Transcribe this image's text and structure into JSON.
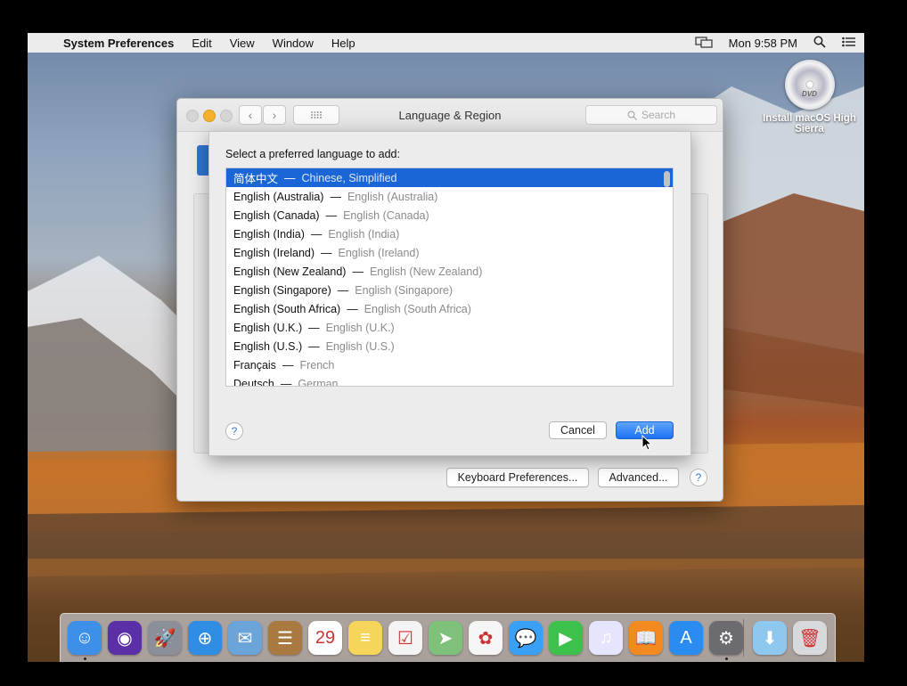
{
  "menubar": {
    "apple": "",
    "app": "System Preferences",
    "items": [
      "Edit",
      "View",
      "Window",
      "Help"
    ],
    "clock": "Mon 9:58 PM"
  },
  "desktop": {
    "disc_label": "Install macOS High Sierra",
    "disc_badge": "DVD"
  },
  "window": {
    "title": "Language & Region",
    "search_placeholder": "Search",
    "keyboard_prefs": "Keyboard Preferences...",
    "advanced": "Advanced...",
    "help": "?"
  },
  "sheet": {
    "prompt": "Select a preferred language to add:",
    "languages": [
      {
        "native": "简体中文",
        "english": "Chinese, Simplified",
        "selected": true
      },
      {
        "native": "English (Australia)",
        "english": "English (Australia)"
      },
      {
        "native": "English (Canada)",
        "english": "English (Canada)"
      },
      {
        "native": "English (India)",
        "english": "English (India)"
      },
      {
        "native": "English (Ireland)",
        "english": "English (Ireland)"
      },
      {
        "native": "English (New Zealand)",
        "english": "English (New Zealand)"
      },
      {
        "native": "English (Singapore)",
        "english": "English (Singapore)"
      },
      {
        "native": "English (South Africa)",
        "english": "English (South Africa)"
      },
      {
        "native": "English (U.K.)",
        "english": "English (U.K.)"
      },
      {
        "native": "English (U.S.)",
        "english": "English (U.S.)"
      },
      {
        "native": "Français",
        "english": "French"
      },
      {
        "native": "Deutsch",
        "english": "German"
      }
    ],
    "separator": "—",
    "help": "?",
    "cancel": "Cancel",
    "add": "Add"
  },
  "dock": {
    "items": [
      {
        "name": "finder-icon",
        "color": "#3d8fe8",
        "glyph": "☺",
        "running": true
      },
      {
        "name": "siri-icon",
        "color": "#5a2fa8",
        "glyph": "◉"
      },
      {
        "name": "launchpad-icon",
        "color": "#8a8f99",
        "glyph": "🚀"
      },
      {
        "name": "safari-icon",
        "color": "#2f8de4",
        "glyph": "⊕"
      },
      {
        "name": "mail-icon",
        "color": "#6aa4d8",
        "glyph": "✉"
      },
      {
        "name": "contacts-icon",
        "color": "#a9793f",
        "glyph": "☰"
      },
      {
        "name": "calendar-icon",
        "color": "#ffffff",
        "glyph": "29"
      },
      {
        "name": "notes-icon",
        "color": "#f6d65a",
        "glyph": "≡"
      },
      {
        "name": "reminders-icon",
        "color": "#f4f4f4",
        "glyph": "☑"
      },
      {
        "name": "maps-icon",
        "color": "#7fc07a",
        "glyph": "➤"
      },
      {
        "name": "photos-icon",
        "color": "#f5f5f5",
        "glyph": "✿"
      },
      {
        "name": "messages-icon",
        "color": "#3aa0f5",
        "glyph": "💬"
      },
      {
        "name": "facetime-icon",
        "color": "#3cc24c",
        "glyph": "▶"
      },
      {
        "name": "itunes-icon",
        "color": "#e5e5ff",
        "glyph": "♫"
      },
      {
        "name": "ibooks-icon",
        "color": "#f28a1f",
        "glyph": "📖"
      },
      {
        "name": "app-store-icon",
        "color": "#2a8cf0",
        "glyph": "A"
      },
      {
        "name": "system-preferences-icon",
        "color": "#6b6b70",
        "glyph": "⚙",
        "running": true
      },
      {
        "name": "downloads-folder-icon",
        "color": "#8ec8ee",
        "glyph": "⬇"
      },
      {
        "name": "trash-icon",
        "color": "#d7d9dc",
        "glyph": "🗑"
      }
    ]
  }
}
